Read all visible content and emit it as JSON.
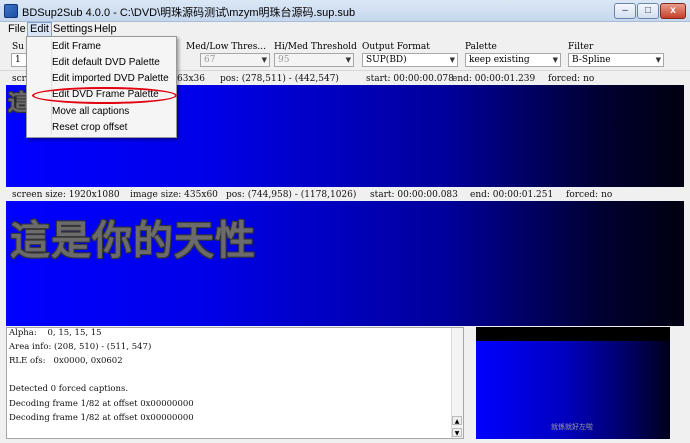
{
  "window": {
    "title": "BDSup2Sub 4.0.0 - C:\\DVD\\明珠源码测试\\mzym明珠台源码.sup.sub",
    "min_label": "–",
    "max_label": "□",
    "close_label": "x"
  },
  "menubar": {
    "file": "File",
    "edit": "Edit",
    "settings": "Settings",
    "help": "Help"
  },
  "toolbar": {
    "sub_label": "Su",
    "sub_value": "1",
    "med_low_label": "Med/Low Thres...",
    "med_low_value": "67",
    "hi_med_label": "Hi/Med Threshold",
    "hi_med_value": "95",
    "output_format_label": "Output Format",
    "output_format_value": "SUP(BD)",
    "palette_label": "Palette",
    "palette_value": "keep existing",
    "filter_label": "Filter",
    "filter_value": "B-Spline"
  },
  "edit_menu": {
    "items": [
      "Edit Frame",
      "Edit default DVD Palette",
      "Edit imported DVD Palette",
      "Edit DVD Frame Palette",
      "Move all captions",
      "Reset crop offset"
    ],
    "highlight_color": "#e2000e"
  },
  "info_top": {
    "screen": "scr",
    "image_size": "63x36",
    "pos": "pos: (278,511) - (442,547)",
    "start": "start: 00:00:00.078",
    "end": "end: 00:00:01.239",
    "forced": "forced: no"
  },
  "info_bottom": {
    "screen": "screen size: 1920x1080",
    "image_size": "image size: 435x60",
    "pos": "pos: (744,958) - (1178,1026)",
    "start": "start: 00:00:00.083",
    "end": "end: 00:00:01.251",
    "forced": "forced: no"
  },
  "preview": {
    "top_caption": "這",
    "bottom_caption": "這是你的天性",
    "caption_color": "#6b6b6b",
    "background_color": "#0000ff"
  },
  "log": {
    "lines": [
      "Alpha:    0, 15, 15, 15",
      "Area info: (208, 510) - (511, 547)",
      "RLE ofs:   0x0000, 0x0602",
      "",
      "Detected 0 forced captions.",
      "Decoding frame 1/82 at offset 0x00000000",
      "Decoding frame 1/82 at offset 0x00000000"
    ]
  },
  "thumbnail": {
    "caption": "就係就好左啦"
  }
}
